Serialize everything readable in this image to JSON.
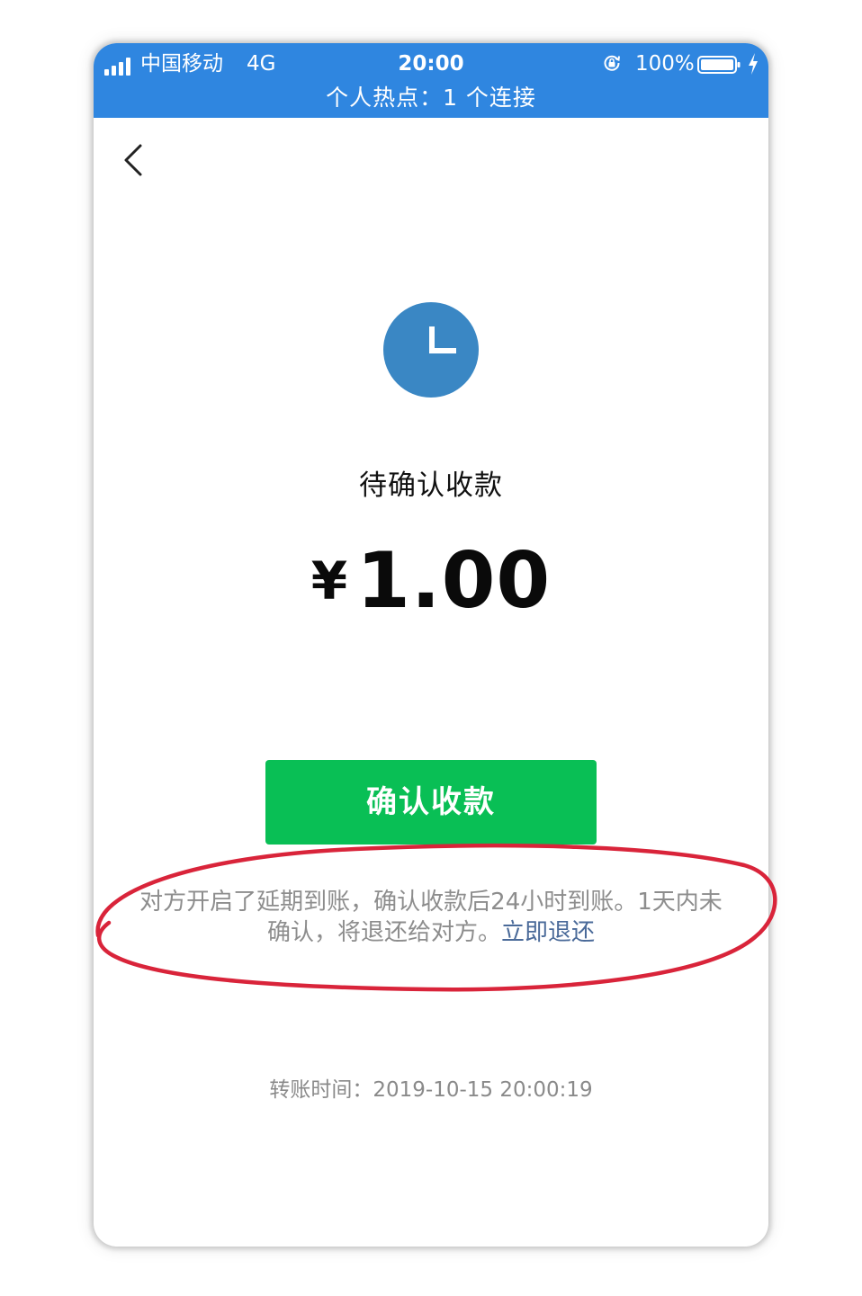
{
  "status_bar": {
    "carrier": "中国移动",
    "network": "4G",
    "time": "20:00",
    "battery": "100%",
    "hotspot": "个人热点：1 个连接",
    "background_color": "#2f86e0"
  },
  "header": {
    "back_icon": "chevron-left-icon"
  },
  "status": {
    "icon": "clock-icon",
    "icon_color": "#3a87c4",
    "title": "待确认收款"
  },
  "amount": {
    "currency": "¥",
    "value": "1.00"
  },
  "confirm_button": {
    "label": "确认收款",
    "color": "#09bf55"
  },
  "notice": {
    "line1": "对方开启了延期到账，确认收款后24小时到账。1天内未",
    "line2": "确认，将退还给对方。",
    "refund_link": "立即退还",
    "link_color": "#4a6a99"
  },
  "transfer_time": {
    "text": "转账时间：2019-10-15 20:00:19"
  },
  "annotation": {
    "color": "#d9243a"
  }
}
